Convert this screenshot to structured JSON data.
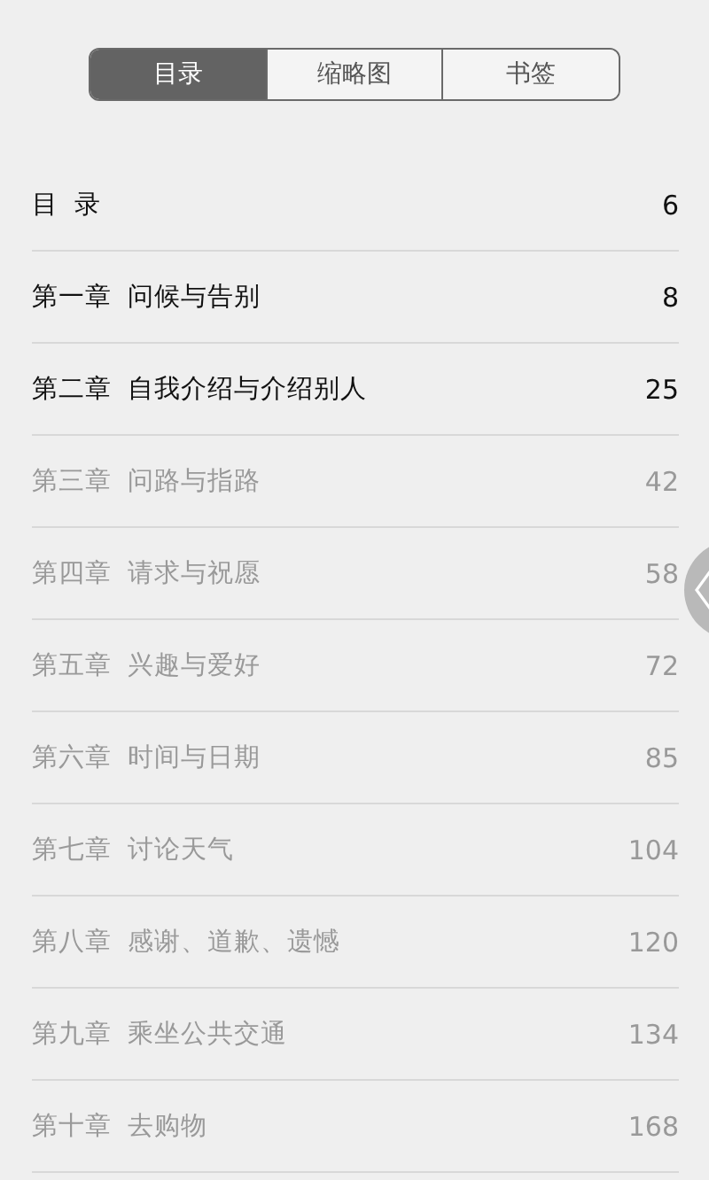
{
  "tabs": [
    {
      "label": "目录",
      "selected": true
    },
    {
      "label": "缩略图",
      "selected": false
    },
    {
      "label": "书签",
      "selected": false
    }
  ],
  "contents": [
    {
      "title": "目  录",
      "page": "6",
      "dimmed": false
    },
    {
      "title": "第一章  问候与告别",
      "page": "8",
      "dimmed": false
    },
    {
      "title": "第二章  自我介绍与介绍别人",
      "page": "25",
      "dimmed": false
    },
    {
      "title": "第三章  问路与指路",
      "page": "42",
      "dimmed": true
    },
    {
      "title": "第四章  请求与祝愿",
      "page": "58",
      "dimmed": true
    },
    {
      "title": "第五章  兴趣与爱好",
      "page": "72",
      "dimmed": true
    },
    {
      "title": "第六章  时间与日期",
      "page": "85",
      "dimmed": true
    },
    {
      "title": "第七章  讨论天气",
      "page": "104",
      "dimmed": true
    },
    {
      "title": "第八章  感谢、道歉、遗憾",
      "page": "120",
      "dimmed": true
    },
    {
      "title": "第九章  乘坐公共交通",
      "page": "134",
      "dimmed": true
    },
    {
      "title": "第十章  去购物",
      "page": "168",
      "dimmed": true
    }
  ]
}
